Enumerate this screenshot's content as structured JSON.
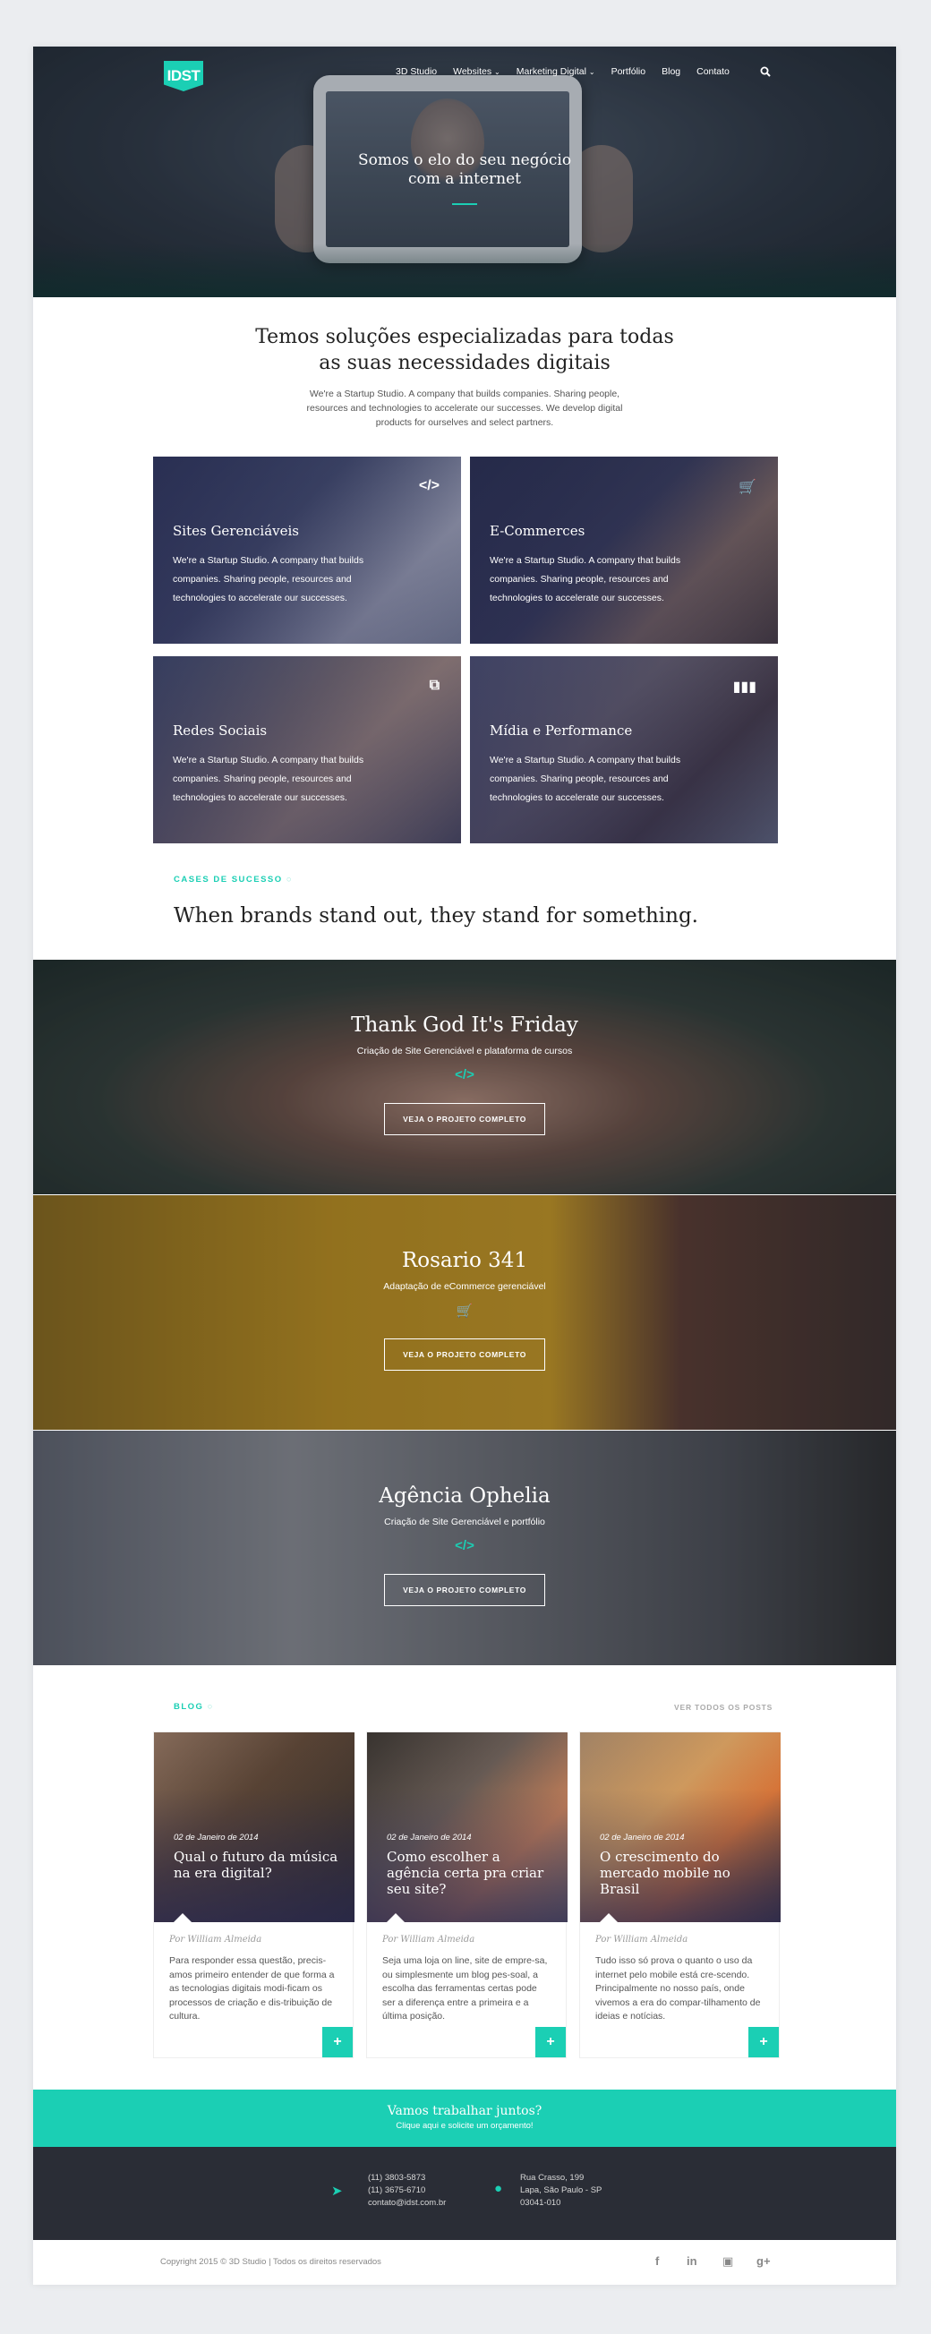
{
  "nav": {
    "logo": "IDST",
    "items": [
      "3D Studio",
      "Websites",
      "Marketing Digital",
      "Portfólio",
      "Blog",
      "Contato"
    ]
  },
  "hero": {
    "title_line1": "Somos o elo do seu negócio",
    "title_line2": "com a internet"
  },
  "intro": {
    "title_line1": "Temos soluções especializadas para todas",
    "title_line2": "as suas necessidades digitais",
    "text": "We're a Startup Studio. A company that builds companies. Sharing people, resources and technologies to accelerate our successes. We develop digital products for ourselves and select partners."
  },
  "services": [
    {
      "title": "Sites Gerenciáveis",
      "text": "We're a Startup Studio. A company that builds companies. Sharing people, resources and technologies to accelerate our successes.",
      "icon": "code-icon"
    },
    {
      "title": "E-Commerces",
      "text": "We're a Startup Studio. A company that builds companies. Sharing people, resources and technologies to accelerate our successes.",
      "icon": "cart-icon"
    },
    {
      "title": "Redes Sociais",
      "text": "We're a Startup Studio. A company that builds companies. Sharing people, resources and technologies to accelerate our successes.",
      "icon": "share-icon"
    },
    {
      "title": "Mídia e Performance",
      "text": "We're a Startup Studio. A company that builds companies. Sharing people, resources and technologies to accelerate our successes.",
      "icon": "chart-icon"
    }
  ],
  "cases": {
    "label": "CASES DE SUCESSO",
    "title": "When brands stand out, they stand for something.",
    "items": [
      {
        "title": "Thank God It's Friday",
        "subtitle": "Criação de Site Gerenciável e plataforma de cursos",
        "button": "VEJA O PROJETO COMPLETO",
        "icon": "code-icon"
      },
      {
        "title": "Rosario 341",
        "subtitle": "Adaptação de eCommerce gerenciável",
        "button": "VEJA O PROJETO COMPLETO",
        "icon": "cart-icon"
      },
      {
        "title": "Agência Ophelia",
        "subtitle": "Criação de Site Gerenciável e portfólio",
        "button": "VEJA O PROJETO COMPLETO",
        "icon": "code-icon"
      }
    ]
  },
  "blog": {
    "label": "BLOG",
    "all_posts": "VER TODOS OS POSTS",
    "posts": [
      {
        "date": "02 de Janeiro de 2014",
        "title": "Qual o futuro da música na era digital?",
        "author": "Por William Almeida",
        "excerpt": "Para responder essa questão, precis-amos primeiro entender de que forma a as tecnologias digitais modi-ficam os processos de criação e dis-tribuição de cultura."
      },
      {
        "date": "02 de Janeiro de 2014",
        "title": "Como escolher a agência certa pra criar seu site?",
        "author": "Por William Almeida",
        "excerpt": "Seja uma loja on line, site de empre-sa, ou simplesmente um blog pes-soal, a escolha das ferramentas certas pode ser a diferença entre a primeira e a última posição."
      },
      {
        "date": "02 de Janeiro de 2014",
        "title": "O crescimento do mercado mobile no Brasil",
        "author": "Por William Almeida",
        "excerpt": "Tudo isso só prova o quanto o uso da internet pelo mobile está cre-scendo. Principalmente no nosso país, onde vivemos a era do compar-tilhamento de ideias e notícias."
      }
    ]
  },
  "cta": {
    "title": "Vamos trabalhar juntos?",
    "subtitle": "Clique aqui e solicite um orçamento!"
  },
  "contact": {
    "phone1": "(11) 3803-5873",
    "phone2": "(11) 3675-6710",
    "email": "contato@idst.com.br",
    "address1": "Rua Crasso, 199",
    "address2": "Lapa, São Paulo - SP",
    "address3": "03041-010"
  },
  "footer": {
    "copyright": "Copyright 2015 © 3D Studio | Todos os direitos reservados"
  },
  "colors": {
    "accent": "#1bcfb4",
    "dark": "#2a2d36"
  }
}
